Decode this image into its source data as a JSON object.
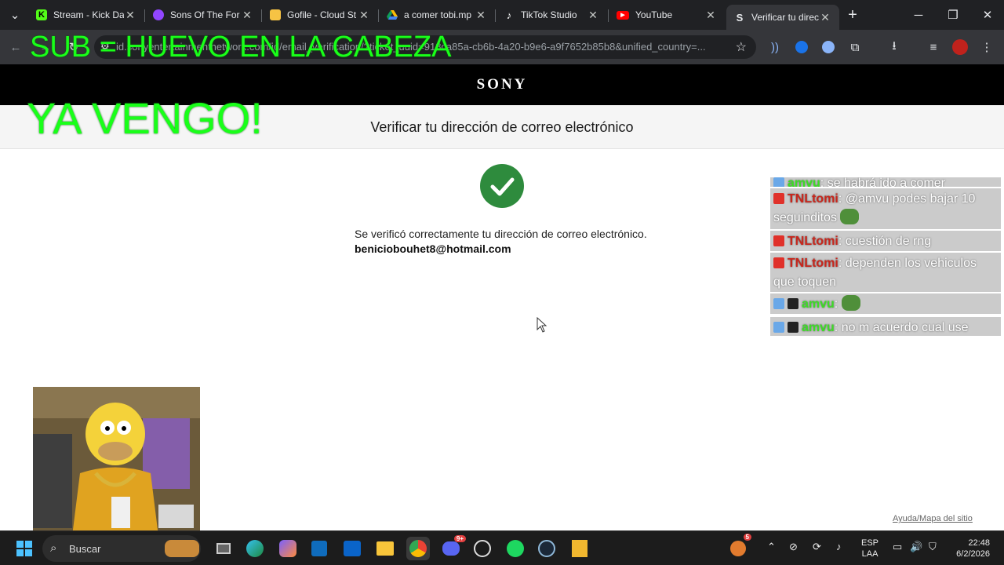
{
  "browser": {
    "tabs": [
      {
        "label": "Stream - Kick Da",
        "icon": "kick-icon",
        "color": "#53fc18"
      },
      {
        "label": "Sons Of The For",
        "icon": "twitch-like-icon",
        "color": "#9146ff"
      },
      {
        "label": "Gofile - Cloud St",
        "icon": "gofile-icon",
        "color": "#f6c344"
      },
      {
        "label": "a comer tobi.mp",
        "icon": "google-drive-icon",
        "color": "#4285f4"
      },
      {
        "label": "TikTok Studio",
        "icon": "tiktok-icon",
        "color": "#ffffff"
      },
      {
        "label": "YouTube",
        "icon": "youtube-icon",
        "color": "#ff0000"
      },
      {
        "label": "Verificar tu direc",
        "icon": "sony-s-icon",
        "color": "#e8eaed"
      }
    ],
    "url": "id.sonyentertainmentnetwork.com/id/email_verification/?ticket_uuid=918ca85a-cb6b-4a20-b9e6-a9f7652b85b8&unified_country=..."
  },
  "overlay": {
    "line1": "SUB = HUEVO EN LA CABEZA",
    "line2": "YA VENGO!"
  },
  "page": {
    "brand": "SONY",
    "title": "Verificar tu dirección de correo electrónico",
    "success_message": "Se verificó correctamente tu dirección de correo electrónico.",
    "email": "beniciobouhet8@hotmail.com",
    "footer_link": "Ayuda/Mapa del sitio"
  },
  "chat": {
    "messages": [
      {
        "user": "amvu",
        "text": ": se habrá ido a comer",
        "user_color": "green"
      },
      {
        "user": "TNLtomi",
        "text": ": @amvu podes bajar 10 seguinditos",
        "user_color": "red"
      },
      {
        "user": "TNLtomi",
        "text": ": cuestión de rng",
        "user_color": "red"
      },
      {
        "user": "TNLtomi",
        "text": ": dependen los vehiculos que toquen",
        "user_color": "red"
      },
      {
        "user": "amvu",
        "text": ":",
        "user_color": "green"
      },
      {
        "user": "amvu",
        "text": ": no m acuerdo cual use",
        "user_color": "green"
      }
    ]
  },
  "taskbar": {
    "search_placeholder": "Buscar",
    "language_line1": "ESP",
    "language_line2": "LAA",
    "time": "22:48",
    "date": "6/2/2026",
    "discord_badge": "9+",
    "notif_badge": "5"
  },
  "colors": {
    "success_green": "#2e8b3d",
    "overlay_green": "#19ff19"
  }
}
